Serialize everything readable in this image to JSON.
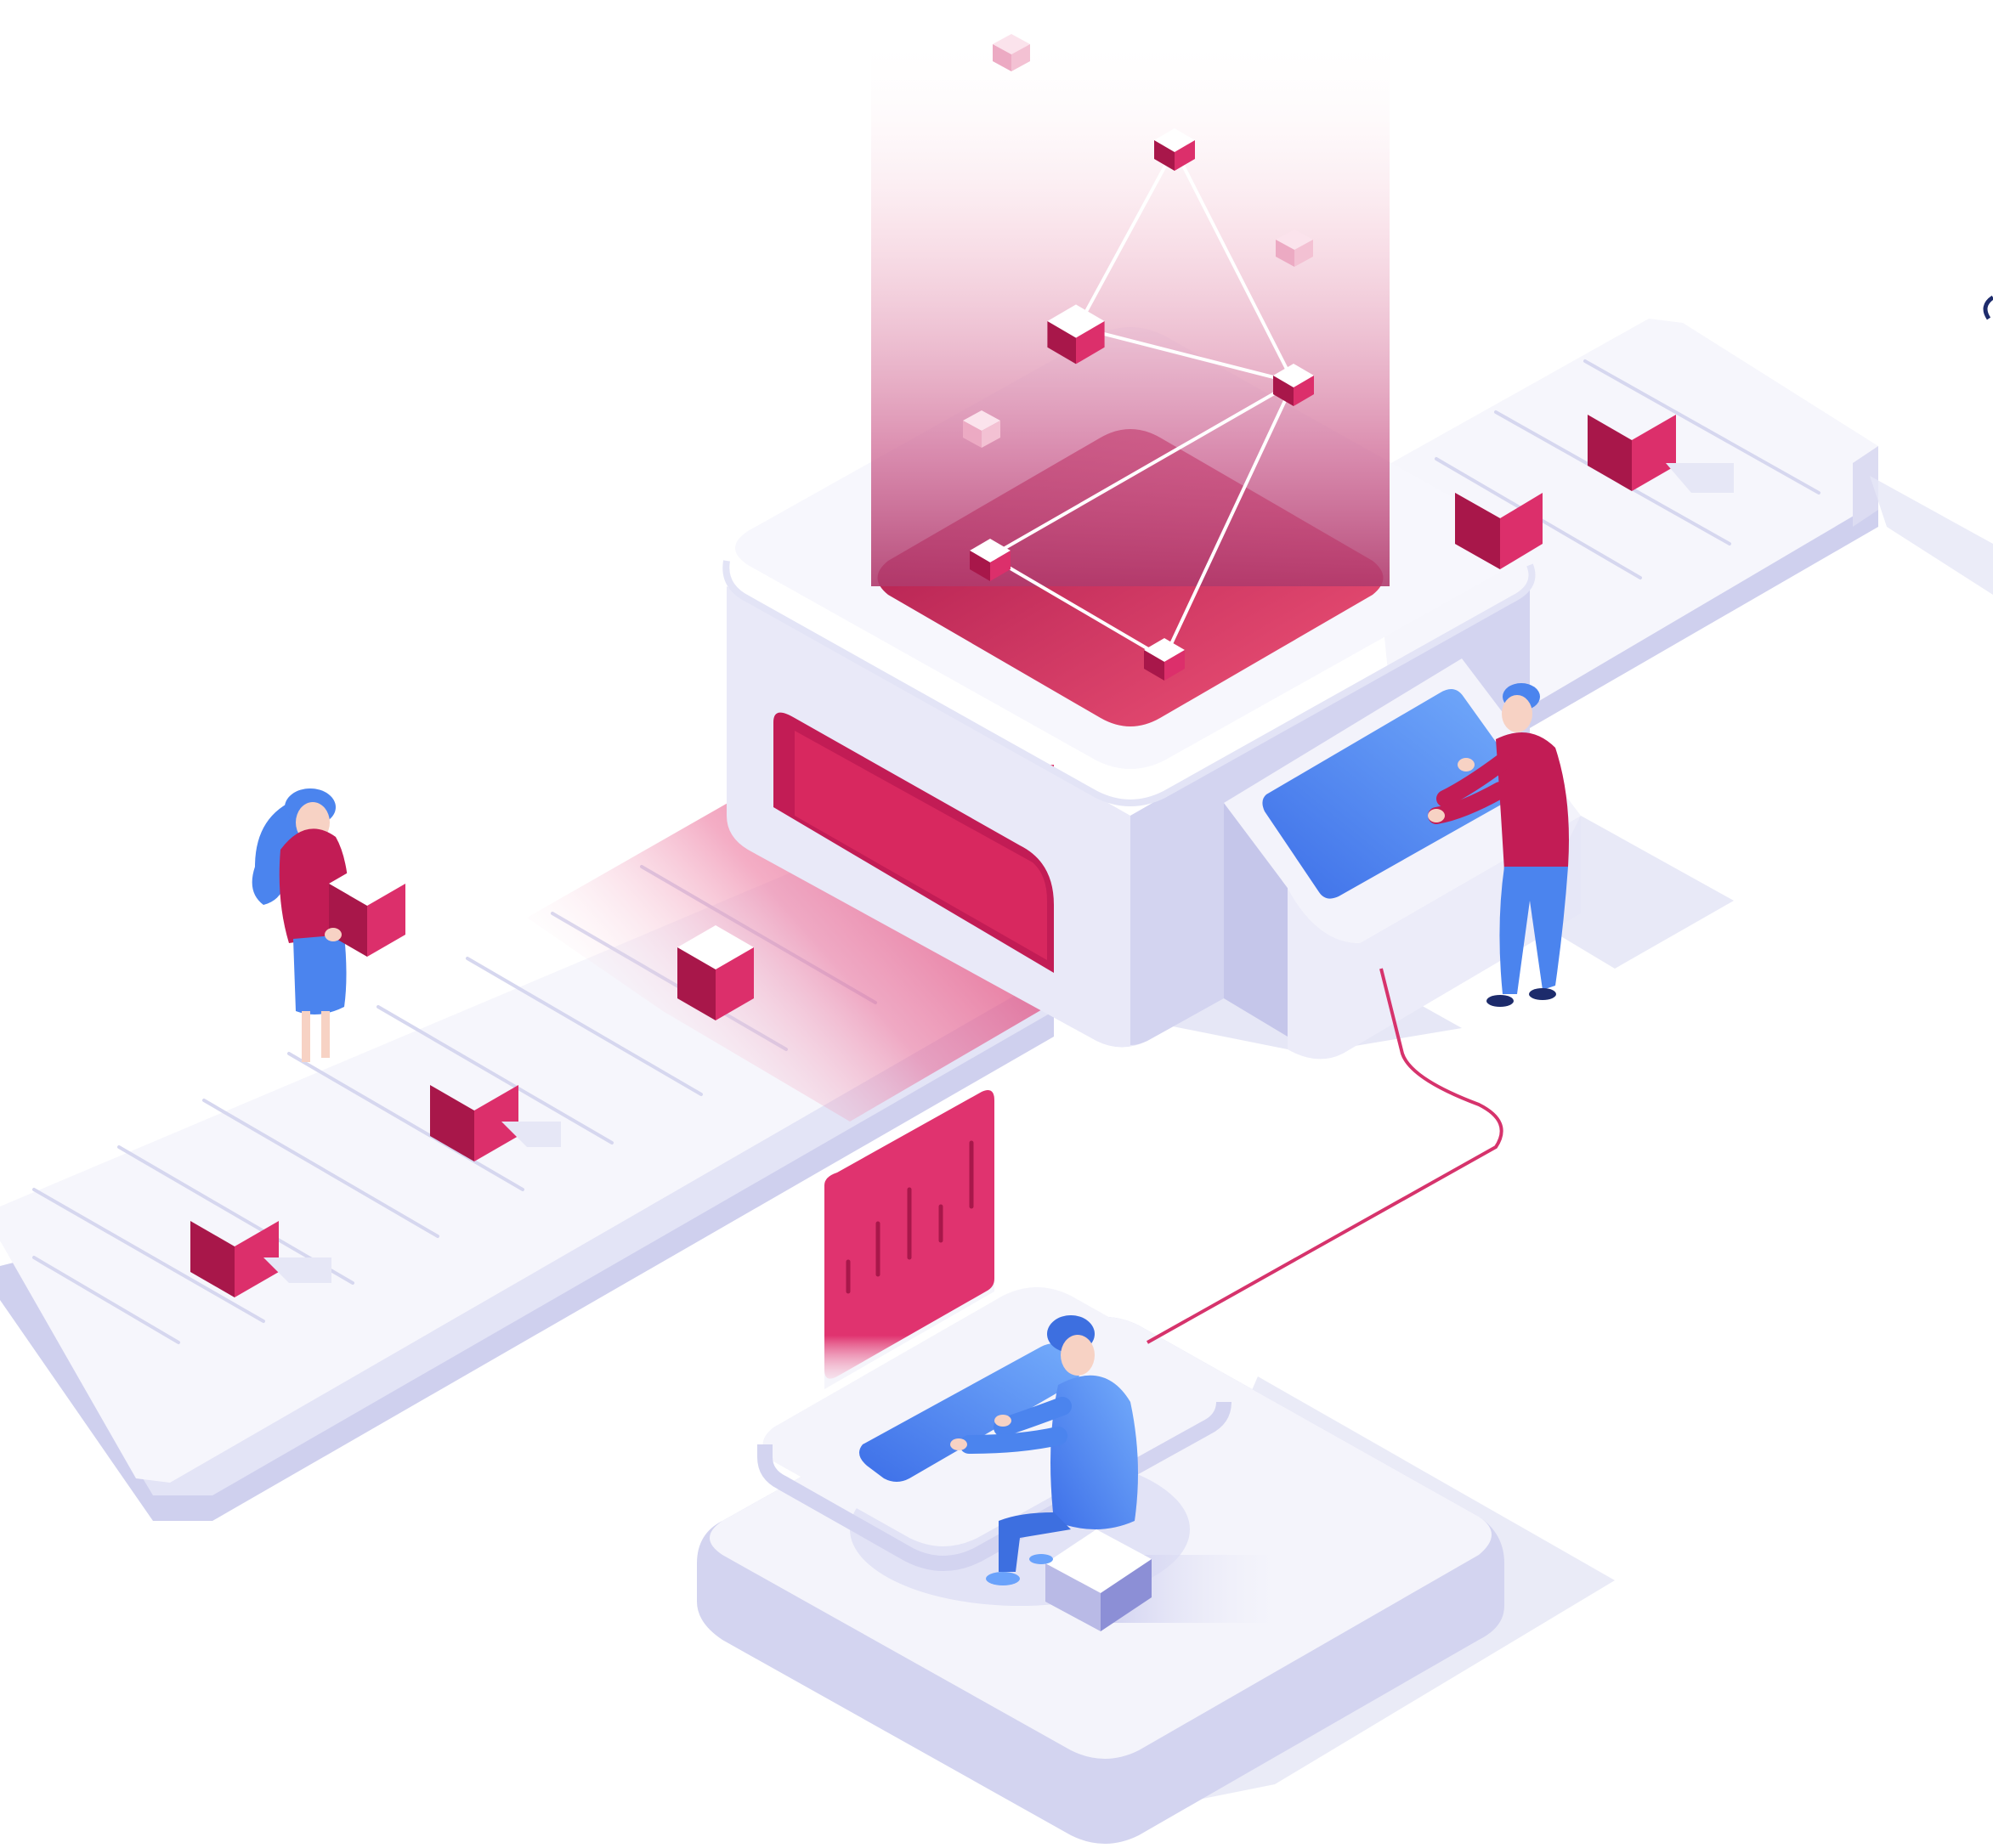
{
  "illustration": {
    "subject": "",
    "palette": {
      "background": "#ffffff",
      "platform_top": "#f4f4fb",
      "platform_left": "#dcdcf2",
      "platform_right": "#c5c6ea",
      "platform_shadow": "#e6e7f6",
      "belt_line": "#d6d7ef",
      "cube_top": "#ffffff",
      "cube_left": "#a8174a",
      "cube_right": "#dc2f6b",
      "accent_pink": "#e0336f",
      "accent_deep": "#a8174a",
      "screen_blue": "#4a7cf0",
      "screen_blue_light": "#6aa2fb",
      "skin": "#f7d2c4",
      "hair": "#3d6fe0",
      "cable": "#d6336c"
    },
    "icons": [
      "cube-icon",
      "network-node-icon",
      "bar-chart-icon",
      "person-icon",
      "laptop-icon",
      "touchscreen-icon"
    ]
  }
}
